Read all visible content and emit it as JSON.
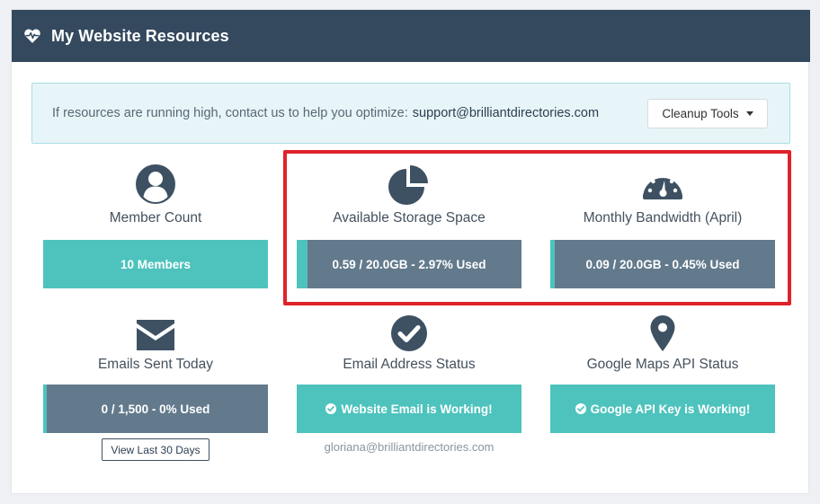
{
  "header": {
    "title": "My Website Resources",
    "icon": "heartbeat-icon"
  },
  "alert": {
    "message": "If resources are running high, contact us to help you optimize:",
    "email": "support@brilliantdirectories.com",
    "cleanup_label": "Cleanup Tools"
  },
  "stats": {
    "members": {
      "label": "Member Count",
      "bar_text": "10 Members",
      "icon": "user-icon"
    },
    "storage": {
      "label": "Available Storage Space",
      "bar_text": "0.59 / 20.0GB - 2.97% Used",
      "used_fraction": 0.0297,
      "icon": "pie-chart-icon"
    },
    "bandwidth": {
      "label": "Monthly Bandwidth (April)",
      "bar_text": "0.09 / 20.0GB - 0.45% Used",
      "used_fraction": 0.0045,
      "icon": "gauge-icon"
    },
    "emails": {
      "label": "Emails Sent Today",
      "bar_text": "0 / 1,500 - 0% Used",
      "used_fraction": 0.0,
      "button_label": "View Last 30 Days",
      "icon": "envelope-icon"
    },
    "email_status": {
      "label": "Email Address Status",
      "bar_text": "Website Email is Working!",
      "subtext": "gloriana@brilliantdirectories.com",
      "icon": "check-circle-icon"
    },
    "maps": {
      "label": "Google Maps API Status",
      "bar_text": "Google API Key is Working!",
      "icon": "map-marker-icon"
    }
  },
  "colors": {
    "header_bg": "#34495e",
    "teal": "#4ec3bd",
    "slate": "#637a8d",
    "highlight": "#e0222a",
    "icon": "#3d5163"
  }
}
